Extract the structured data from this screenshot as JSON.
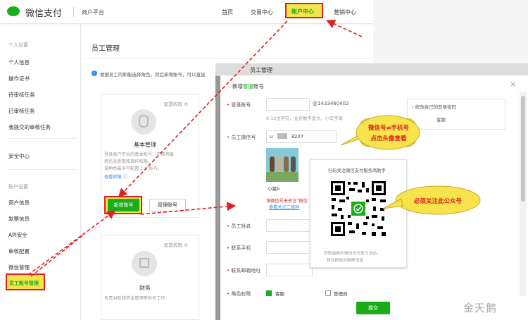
{
  "header": {
    "logo_text": "微信支付",
    "merchant_platform": "商户平台",
    "nav": [
      "首页",
      "交易中心",
      "账户中心",
      "营销中心"
    ]
  },
  "sidebar": {
    "section1": "个人设置",
    "items1": [
      "个人信息",
      "操作证书",
      "待审核任务",
      "已审核任务",
      "我提交的审核任务"
    ],
    "security": "安全中心",
    "section2": "账户设置",
    "items2": [
      "商户信息",
      "发票信息",
      "API安全",
      "审核配置",
      "微信管理"
    ],
    "staff_mgmt": "员工账号管理"
  },
  "main": {
    "title": "员工管理",
    "info_icon": "i",
    "info_text": "根据员工的职能选择角色，然后新增账号，可以直接",
    "card1": {
      "config": "配置权限 ⚙",
      "role": "基本管理",
      "desc": [
        "登录商户平台的基本账号，不具有敏",
        "感信息查看和操作权限。",
        "该角色最多可配置 1 个账号。",
        "查看权限 ⓘ"
      ],
      "add_button": "新增账号",
      "manage_button": "管理账号"
    },
    "card2": {
      "config": "配置权限 ⚙",
      "role": "财务",
      "desc": "负责对账和资金管理等财务工作"
    }
  },
  "dialog": {
    "header_title": "员工管理",
    "title_prefix": "新增",
    "title_green": "客服",
    "title_suffix": "账号",
    "close": "×",
    "login_label": "登录账号",
    "login_suffix": "@1433460402",
    "login_hint": "6-12位字符，允许数字及大、小写字母",
    "wechat_label": "员工微信号",
    "wechat_value_start": "u",
    "wechat_value_end": "3227",
    "avatar_name": "小猪b",
    "error_text": "该微信号未关注“微信",
    "qr_link": "查看关注二维码",
    "name_label": "员工姓名",
    "phone_label": "联系手机",
    "email_label": "联系邮箱地址",
    "role_label": "角色权限",
    "role_opt1": "客服",
    "role_opt2": "管理员",
    "submit": "提交",
    "right_item1": "修改自己的登录密码",
    "right_item2": "客服"
  },
  "qr_popup": {
    "title": "扫码关注微信支付服务商助手",
    "note1": "获取最新的微信支付官方动态、",
    "note2": "移动刷脸的新鲜消息"
  },
  "callouts": {
    "wechat_tip_line1": "微信号≠手机号",
    "wechat_tip_line2": "点击头像查看",
    "follow_tip": "必须关注此公众号"
  },
  "watermark": "金天鹅",
  "colors": {
    "brand_green": "#1aad19",
    "highlight_red": "#e02020",
    "highlight_yellow": "#f4e54a",
    "callout_yellow": "#f7e34c"
  }
}
